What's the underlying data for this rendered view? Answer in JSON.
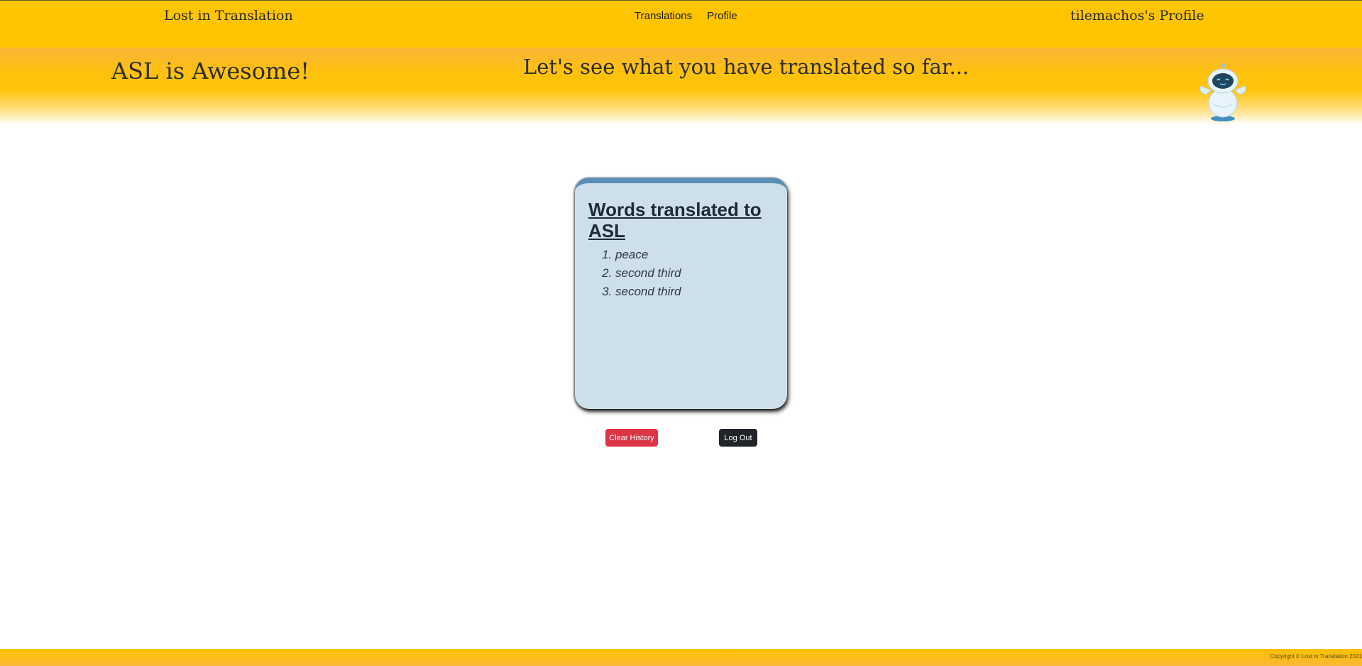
{
  "navbar": {
    "brand": "Lost in Translation",
    "links": [
      "Translations",
      "Profile"
    ],
    "profile_link": "tilemachos's Profile"
  },
  "hero": {
    "title": "ASL is Awesome!",
    "subtitle": "Let's see what you have translated so far..."
  },
  "history_card": {
    "title": "Words translated to ASL",
    "items": [
      "peace",
      "second third",
      "second third"
    ]
  },
  "actions": {
    "clear_label": "Clear History",
    "logout_label": "Log Out"
  },
  "footer": {
    "copyright": "Copyright © Lost in Translation 2021"
  },
  "colors": {
    "primary_yellow": "#ffc501",
    "card_background": "#ccdfea",
    "card_top_border": "#5a8fb5",
    "danger": "#dc3545",
    "dark": "#212529"
  },
  "icons": {
    "mascot": "robot-mascot-icon"
  }
}
